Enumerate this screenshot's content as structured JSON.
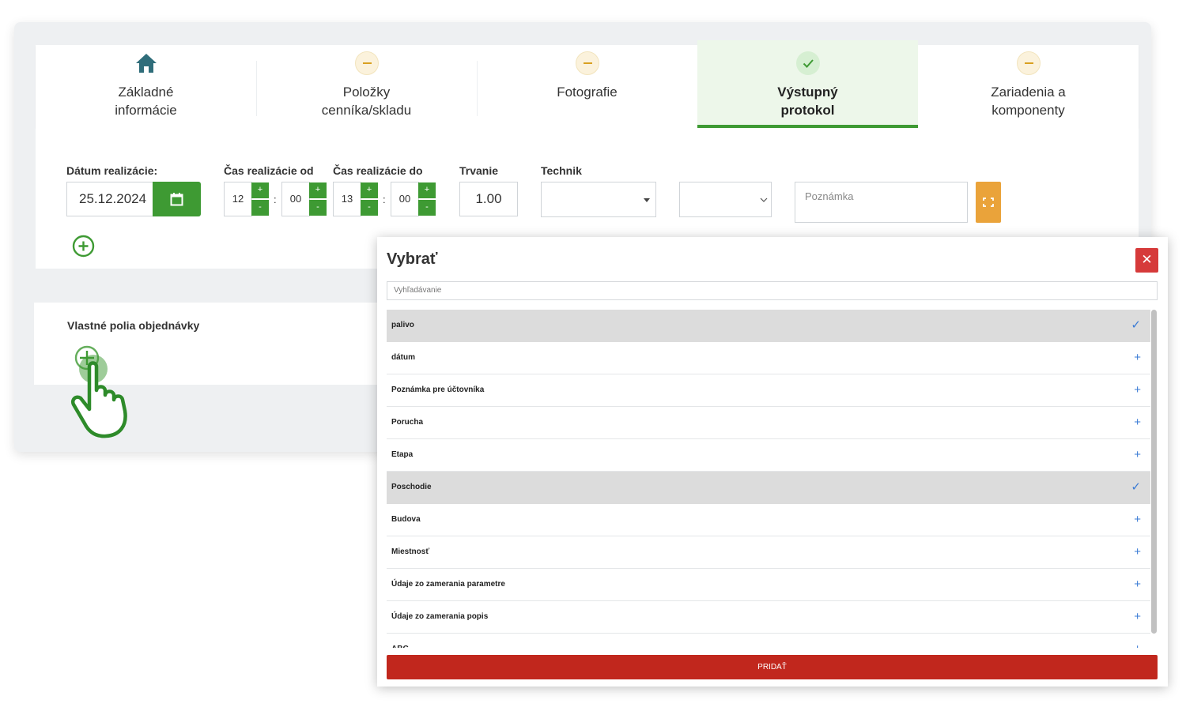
{
  "tabs": [
    {
      "label_line1": "Základné",
      "label_line2": "informácie",
      "status": "home"
    },
    {
      "label_line1": "Položky",
      "label_line2": "cenníka/skladu",
      "status": "pending"
    },
    {
      "label_line1": "Fotografie",
      "label_line2": "",
      "status": "pending"
    },
    {
      "label_line1": "Výstupný",
      "label_line2": "protokol",
      "status": "done"
    },
    {
      "label_line1": "Zariadenia a",
      "label_line2": "komponenty",
      "status": "pending"
    }
  ],
  "form": {
    "date_label": "Dátum realizácie:",
    "date_value": "25.12.2024",
    "time_from_label": "Čas realizácie od",
    "time_from_hours": "12",
    "time_from_minutes": "00",
    "time_to_label": "Čas realizácie do",
    "time_to_hours": "13",
    "time_to_minutes": "00",
    "duration_label": "Trvanie",
    "duration_value": "1.00",
    "technician_label": "Technik",
    "note_placeholder": "Poznámka",
    "plus": "+",
    "minus": "-",
    "colon": ":"
  },
  "custom_fields": {
    "title": "Vlastné polia objednávky"
  },
  "modal": {
    "title": "Vybrať",
    "close": "✕",
    "search_placeholder": "Vyhľadávanie",
    "items": [
      {
        "label": "palivo",
        "selected": true,
        "mark": "✓"
      },
      {
        "label": "dátum",
        "selected": false,
        "mark": "+"
      },
      {
        "label": "Poznámka pre účtovníka",
        "selected": false,
        "mark": "+"
      },
      {
        "label": "Porucha",
        "selected": false,
        "mark": "+"
      },
      {
        "label": "Etapa",
        "selected": false,
        "mark": "+"
      },
      {
        "label": "Poschodie",
        "selected": true,
        "mark": "✓"
      },
      {
        "label": "Budova",
        "selected": false,
        "mark": "+"
      },
      {
        "label": "Miestnosť",
        "selected": false,
        "mark": "+"
      },
      {
        "label": "Údaje zo zamerania parametre",
        "selected": false,
        "mark": "+"
      },
      {
        "label": "Údaje zo zamerania popis",
        "selected": false,
        "mark": "+"
      },
      {
        "label": "ABC",
        "selected": false,
        "mark": "+"
      }
    ],
    "add_button": "PRIDAŤ"
  },
  "colors": {
    "green": "#3e9a33",
    "orange": "#eaa33a",
    "red": "#c1271d",
    "close_red": "#d63a3a",
    "link_blue": "#3a7bd5"
  }
}
